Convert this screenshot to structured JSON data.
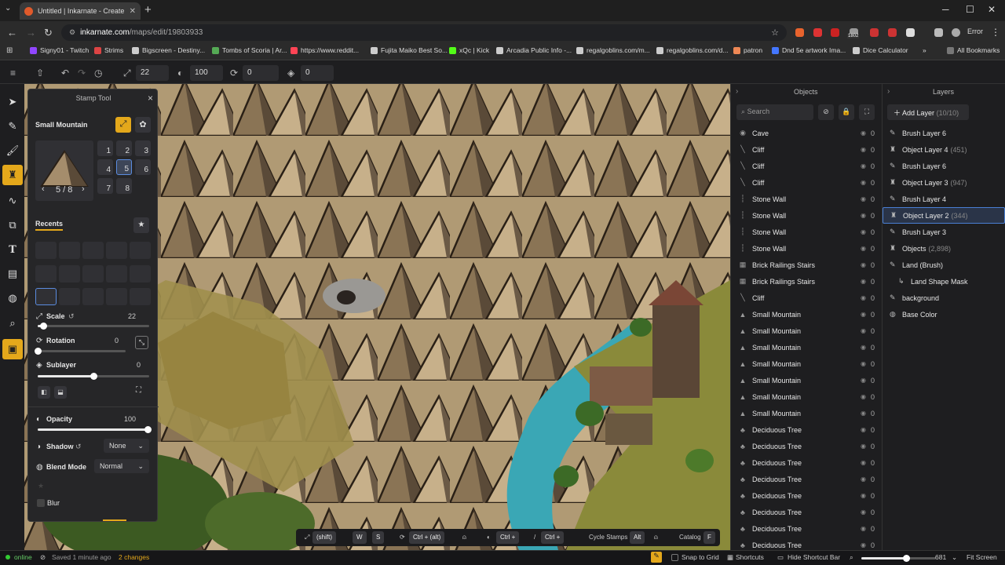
{
  "browser": {
    "tab_title": "Untitled | Inkarnate - Create Fa",
    "url_host": "inkarnate.com",
    "url_path": "/maps/edit/19803933",
    "badge": "1802",
    "error_label": "Error",
    "bookmarks": [
      "Signy01 - Twitch",
      "Strims",
      "Bigscreen - Destiny...",
      "Tombs of Scoria | Ar...",
      "https://www.reddit...",
      "Fujita Maiko Best So...",
      "xQc | Kick",
      "Arcadia Public Info -...",
      "regalgoblins.com/m...",
      "regalgoblins.com/d...",
      "patron",
      "Dnd 5e artwork Ima...",
      "Dice Calculator"
    ],
    "all_bookmarks": "All Bookmarks",
    "more": "»"
  },
  "toolbar": {
    "size": "22",
    "opacity": "100",
    "rotation": "0",
    "sublayer": "0"
  },
  "stamp_panel": {
    "title": "Stamp Tool",
    "close": "×",
    "stamp_name": "Small Mountain",
    "variant_counter": "5 / 8",
    "variants": [
      "1",
      "2",
      "3",
      "4",
      "5",
      "6",
      "7",
      "8"
    ],
    "recents_label": "Recents",
    "scale_label": "Scale",
    "scale_value": "22",
    "rotation_label": "Rotation",
    "rotation_value": "0",
    "sublayer_label": "Sublayer",
    "sublayer_value": "0",
    "opacity_label": "Opacity",
    "opacity_value": "100",
    "shadow_label": "Shadow",
    "shadow_value": "None",
    "blend_label": "Blend Mode",
    "blend_value": "Normal",
    "blur_label": "Blur",
    "scale_level": 0.05,
    "sublayer_level": 0.5,
    "opacity_level": 1.0
  },
  "objects": {
    "title": "Objects",
    "search_placeholder": "Search",
    "items": [
      {
        "name": "Cave",
        "count": "0"
      },
      {
        "name": "Cliff",
        "count": "0"
      },
      {
        "name": "Cliff",
        "count": "0"
      },
      {
        "name": "Cliff",
        "count": "0"
      },
      {
        "name": "Stone Wall",
        "count": "0"
      },
      {
        "name": "Stone Wall",
        "count": "0"
      },
      {
        "name": "Stone Wall",
        "count": "0"
      },
      {
        "name": "Stone Wall",
        "count": "0"
      },
      {
        "name": "Brick Railings Stairs",
        "count": "0"
      },
      {
        "name": "Brick Railings Stairs",
        "count": "0"
      },
      {
        "name": "Cliff",
        "count": "0"
      },
      {
        "name": "Small Mountain",
        "count": "0"
      },
      {
        "name": "Small Mountain",
        "count": "0"
      },
      {
        "name": "Small Mountain",
        "count": "0"
      },
      {
        "name": "Small Mountain",
        "count": "0"
      },
      {
        "name": "Small Mountain",
        "count": "0"
      },
      {
        "name": "Small Mountain",
        "count": "0"
      },
      {
        "name": "Small Mountain",
        "count": "0"
      },
      {
        "name": "Deciduous Tree",
        "count": "0"
      },
      {
        "name": "Deciduous Tree",
        "count": "0"
      },
      {
        "name": "Deciduous Tree",
        "count": "0"
      },
      {
        "name": "Deciduous Tree",
        "count": "0"
      },
      {
        "name": "Deciduous Tree",
        "count": "0"
      },
      {
        "name": "Deciduous Tree",
        "count": "0"
      },
      {
        "name": "Deciduous Tree",
        "count": "0"
      },
      {
        "name": "Deciduous Tree",
        "count": "0"
      }
    ]
  },
  "layers": {
    "title": "Layers",
    "add_label": "Add Layer",
    "add_count": "(10/10)",
    "items": [
      {
        "name": "Brush Layer 6",
        "count": "",
        "icon": "brush"
      },
      {
        "name": "Object Layer 4",
        "count": "(451)",
        "icon": "object"
      },
      {
        "name": "Brush Layer 6",
        "count": "",
        "icon": "brush"
      },
      {
        "name": "Object Layer 3",
        "count": "(947)",
        "icon": "object"
      },
      {
        "name": "Brush Layer 4",
        "count": "",
        "icon": "brush"
      },
      {
        "name": "Object Layer 2",
        "count": "(344)",
        "icon": "object"
      },
      {
        "name": "Brush Layer 3",
        "count": "",
        "icon": "brush"
      },
      {
        "name": "Objects",
        "count": "(2,898)",
        "icon": "object"
      },
      {
        "name": "Land (Brush)",
        "count": "",
        "icon": "brush"
      },
      {
        "name": "Land Shape Mask",
        "count": "",
        "icon": "mask"
      },
      {
        "name": "background",
        "count": "",
        "icon": "brush"
      },
      {
        "name": "Base Color",
        "count": "",
        "icon": "color"
      }
    ],
    "selected_index": 5
  },
  "shortcuts": {
    "shift": "(shift)",
    "w": "W",
    "s": "S",
    "ctrl_alt": "Ctrl + (alt)",
    "ctrl1": "Ctrl +",
    "ctrl2": "Ctrl +",
    "cycle_label": "Cycle Stamps",
    "alt": "Alt",
    "catalog_label": "Catalog",
    "f": "F"
  },
  "status": {
    "online": "online",
    "saved": "Saved 1 minute ago",
    "changes": "2 changes",
    "snap": "Snap to Grid",
    "shortcuts": "Shortcuts",
    "hide_bar": "Hide Shortcut Bar",
    "zoom": "681",
    "fit": "Fit Screen",
    "zoom_level": 0.6
  },
  "colors": {
    "accent": "#e4a81b",
    "river": "#3aa7b5",
    "selection": "#4a7fd4"
  }
}
